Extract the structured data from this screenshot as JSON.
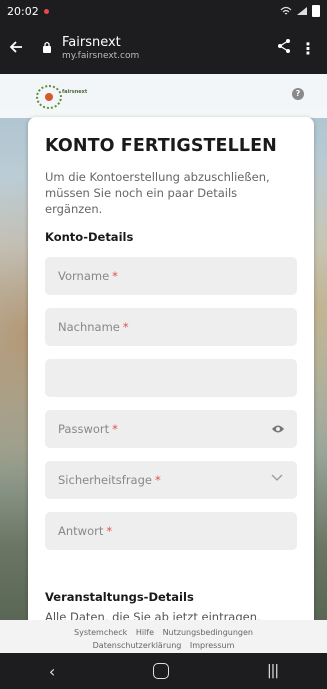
{
  "status": {
    "time": "20:02"
  },
  "browser": {
    "title": "Fairsnext",
    "url": "my.fairsnext.com"
  },
  "logo": {
    "text": "fairsnext"
  },
  "card": {
    "title": "KONTO FERTIGSTELLEN",
    "intro": "Um die Kontoerstellung abzuschließen, müssen Sie noch ein paar Details ergänzen.",
    "section_account": "Konto-Details",
    "fields": {
      "firstname": "Vorname",
      "lastname": "Nachname",
      "blank": "",
      "password": "Passwort",
      "security_question": "Sicherheitsfrage",
      "answer": "Antwort",
      "required_mark": "*"
    },
    "section_event": "Veranstaltungs-Details",
    "event_text": "Alle Daten, die Sie ab jetzt eintragen, werden nicht in Ihrem Fairsnext-Profil"
  },
  "footer": {
    "links": [
      "Systemcheck",
      "Hilfe",
      "Nutzungsbedingungen",
      "Datenschutzerklärung",
      "Impressum"
    ]
  },
  "colors": {
    "required": "#d9534f",
    "field_bg": "#eeeeee",
    "chrome": "#1d1d1f"
  }
}
